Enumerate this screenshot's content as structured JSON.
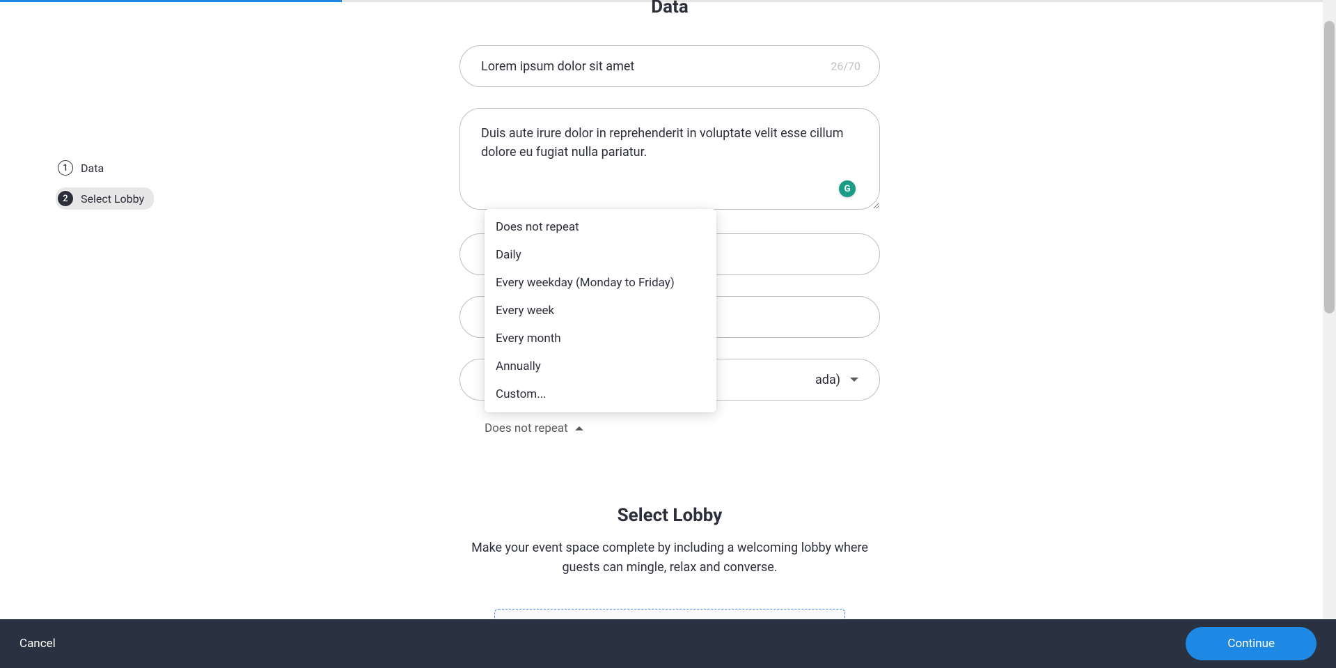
{
  "progress": {
    "percent": 26
  },
  "sidebar": {
    "items": [
      {
        "number": "1",
        "label": "Data",
        "active": false
      },
      {
        "number": "2",
        "label": "Select Lobby",
        "active": true
      }
    ]
  },
  "form": {
    "section_title": "Data",
    "title_input": "Lorem ipsum dolor sit amet",
    "title_char_count": "26/70",
    "description": "Duis aute irure dolor in reprehenderit in voluptate velit esse cillum dolore eu fugiat nulla pariatur.",
    "timezone_partial": "ada)",
    "repeat_label": "Does not repeat"
  },
  "dropdown": {
    "options": [
      "Does not repeat",
      "Daily",
      "Every weekday (Monday to Friday)",
      "Every week",
      "Every month",
      "Annually",
      "Custom..."
    ]
  },
  "section2": {
    "title": "Select Lobby",
    "description": "Make your event space complete by including a welcoming lobby where guests can mingle, relax and converse."
  },
  "footer": {
    "cancel_label": "Cancel",
    "continue_label": "Continue"
  },
  "icons": {
    "grammarly": "G"
  }
}
